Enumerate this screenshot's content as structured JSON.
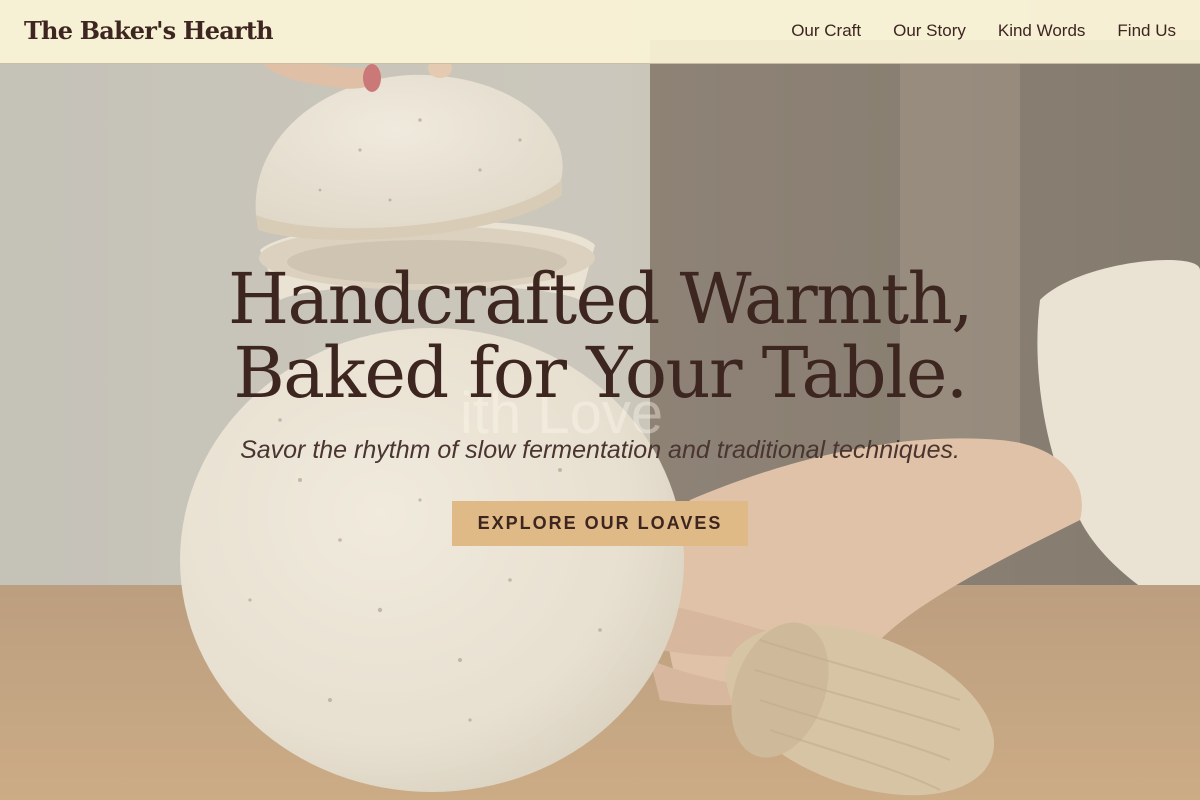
{
  "header": {
    "brand": "The Baker's Hearth",
    "nav": [
      {
        "label": "Our Craft"
      },
      {
        "label": "Our Story"
      },
      {
        "label": "Kind Words"
      },
      {
        "label": "Find Us"
      }
    ]
  },
  "hero": {
    "title_line1": "Handcrafted Warmth,",
    "title_line2": "Baked for Your Table.",
    "ghost_text": "ith Love",
    "subtitle": "Savor the rhythm of slow fermentation and traditional techniques.",
    "cta_label": "EXPLORE OUR LOAVES"
  },
  "colors": {
    "header_bg": "#faf3d7",
    "text_dark": "#3d2620",
    "cta_bg": "#dfb986"
  }
}
